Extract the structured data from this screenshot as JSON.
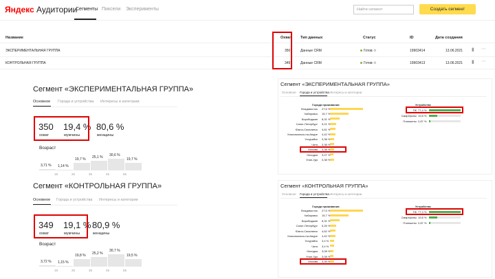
{
  "header": {
    "logo_brand": "Яндекс",
    "logo_product": "Аудитории",
    "tabs": [
      "Сегменты",
      "Пиксели",
      "Эксперименты"
    ],
    "search_placeholder": "Найти сегмент",
    "create_label": "Создать сегмент"
  },
  "table": {
    "headers": {
      "name": "Название",
      "reach": "Охват",
      "type": "Тип данных",
      "status": "Статус",
      "id": "ID",
      "date": "Дата создания"
    },
    "rows": [
      {
        "name": "ЭКСПЕРИМЕНТАЛЬНАЯ ГРУППА",
        "reach": "350",
        "type": "Данные CRM",
        "status": "Готов",
        "id": "19903414",
        "date": "13.06.2021"
      },
      {
        "name": "КОНТРОЛЬНАЯ ГРУППА",
        "reach": "349",
        "type": "Данные CRM",
        "status": "Готов",
        "id": "19903413",
        "date": "13.06.2021"
      }
    ]
  },
  "left_cards": [
    {
      "title": "Сегмент «ЭКСПЕРИМЕНТАЛЬНАЯ ГРУППА»",
      "tabs": [
        "Основное",
        "Города и устройства",
        "Интересы и категории"
      ],
      "reach": "350",
      "reach_label": "охват",
      "male": "19,4 %",
      "male_label": "мужчины",
      "female": "80,6 %",
      "female_label": "женщины",
      "age_title": "Возраст",
      "age": [
        3.71,
        1.14,
        19.7,
        25.1,
        30.6,
        19.7
      ],
      "age_labels": [
        "3,71 %",
        "1,14 %",
        "19,7 %",
        "25,1 %",
        "30,6 %",
        "19,7 %"
      ],
      "age_ticks": [
        "18",
        "25",
        "35",
        "45",
        "55"
      ]
    },
    {
      "title": "Сегмент «КОНТРОЛЬНАЯ ГРУППА»",
      "tabs": [
        "Основное",
        "Города и устройства",
        "Интересы и категории"
      ],
      "reach": "349",
      "reach_label": "охват",
      "male": "19,1 %",
      "male_label": "мужчины",
      "female": "80,9 %",
      "female_label": "женщины",
      "age_title": "Возраст",
      "age": [
        3.72,
        1.15,
        19.8,
        25.2,
        30.7,
        19.5
      ],
      "age_labels": [
        "3,72 %",
        "1,15 %",
        "19,8 %",
        "25,2 %",
        "30,7 %",
        "19,5 %"
      ],
      "age_ticks": [
        "18",
        "25",
        "35",
        "45",
        "55"
      ]
    }
  ],
  "right_cards": [
    {
      "title": "Сегмент «ЭКСПЕРИМЕНТАЛЬНАЯ ГРУППА»",
      "tabs": [
        "Основное",
        "Города и устройства",
        "Интересы и категории"
      ],
      "cities_title": "Города проживания",
      "cities": [
        {
          "name": "Владивосток",
          "pct": "27,6 %",
          "v": 27.6
        },
        {
          "name": "Хабаровск",
          "pct": "15,7 %",
          "v": 15.7
        },
        {
          "name": "Биробиджан",
          "pct": "8,31 %",
          "v": 8.31
        },
        {
          "name": "Санкт-Петербург",
          "pct": "5,21 %",
          "v": 5.21
        },
        {
          "name": "Южно-Сахалинск",
          "pct": "4,61 %",
          "v": 4.61
        },
        {
          "name": "Комсомольск-на-Амуре",
          "pct": "4,42 %",
          "v": 4.42
        },
        {
          "name": "Уссурийск",
          "pct": "3,38 %",
          "v": 3.38
        },
        {
          "name": "Чита",
          "pct": "3,38 %",
          "v": 3.38
        },
        {
          "name": "Москва",
          "pct": "3,38 %",
          "v": 3.38
        },
        {
          "name": "Находка",
          "pct": "3,07 %",
          "v": 3.07
        },
        {
          "name": "Улан-Удэ",
          "pct": "3,38 %",
          "v": 3.38
        }
      ],
      "devices_title": "Устройства",
      "devices": [
        {
          "name": "ПК",
          "pct": "77,4 %",
          "v": 77.4
        },
        {
          "name": "Смартфоны",
          "pct": "19,8 %",
          "v": 19.8
        },
        {
          "name": "Планшеты",
          "pct": "2,87 %",
          "v": 2.87
        }
      ]
    },
    {
      "title": "Сегмент «КОНТРОЛЬНАЯ ГРУППА»",
      "tabs": [
        "Основное",
        "Города и устройства",
        "Интересы и категории"
      ],
      "cities_title": "Города проживания",
      "cities": [
        {
          "name": "Владивосток",
          "pct": "27,5 %",
          "v": 27.5
        },
        {
          "name": "Хабаровск",
          "pct": "15,7 %",
          "v": 15.7
        },
        {
          "name": "Биробиджан",
          "pct": "8,31 %",
          "v": 8.31
        },
        {
          "name": "Санкт-Петербург",
          "pct": "5,25 %",
          "v": 5.25
        },
        {
          "name": "Южно-Сахалинск",
          "pct": "4,62 %",
          "v": 4.62
        },
        {
          "name": "Комсомольск-на-Амуре",
          "pct": "4,42 %",
          "v": 4.42
        },
        {
          "name": "Уссурийск",
          "pct": "3,4 %",
          "v": 3.4
        },
        {
          "name": "Чита",
          "pct": "3,4 %",
          "v": 3.4
        },
        {
          "name": "Находка",
          "pct": "3,08 %",
          "v": 3.08
        },
        {
          "name": "Улан-Удэ",
          "pct": "3,08 %",
          "v": 3.08
        },
        {
          "name": "Москва",
          "pct": "3,39 %",
          "v": 3.39
        }
      ],
      "devices_title": "Устройства",
      "devices": [
        {
          "name": "ПК",
          "pct": "77,3 %",
          "v": 77.3
        },
        {
          "name": "Смартфоны",
          "pct": "19,8 %",
          "v": 19.8
        },
        {
          "name": "Планшеты",
          "pct": "2,87 %",
          "v": 2.87
        }
      ]
    }
  ]
}
